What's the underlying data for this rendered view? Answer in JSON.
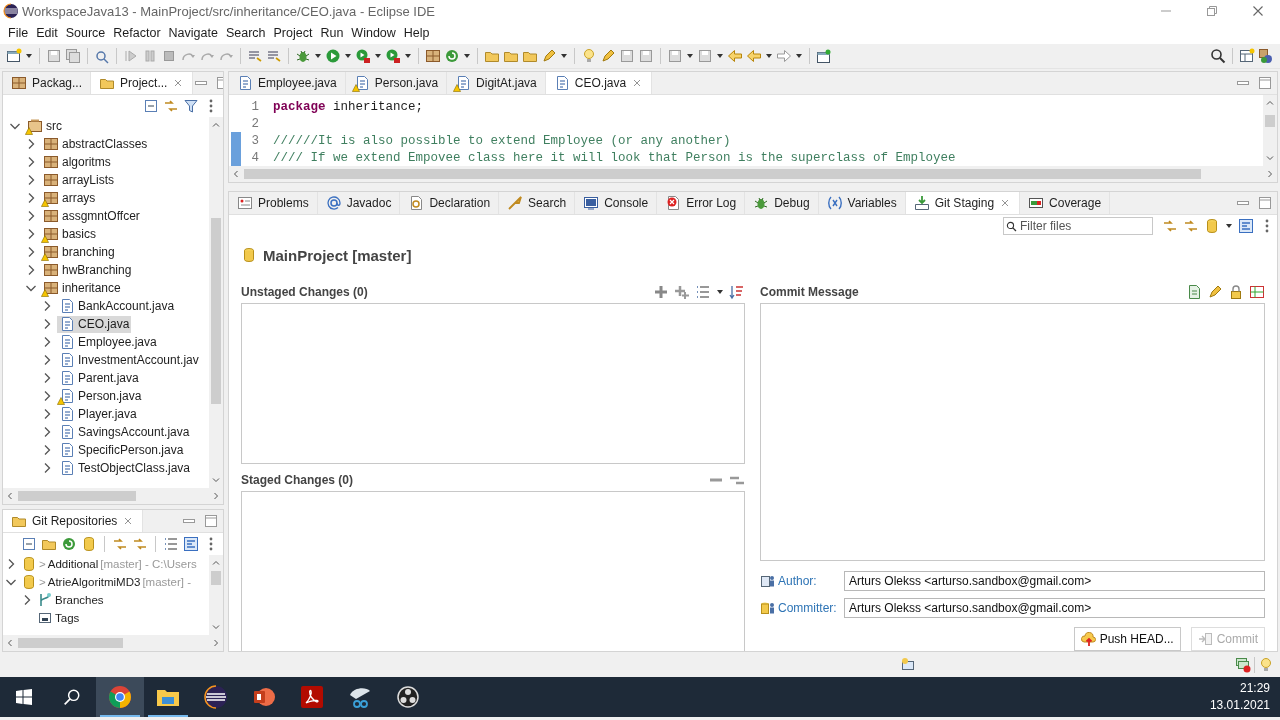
{
  "window": {
    "title": "WorkspaceJava13 - MainProject/src/inheritance/CEO.java - Eclipse IDE"
  },
  "menu": [
    "File",
    "Edit",
    "Source",
    "Refactor",
    "Navigate",
    "Search",
    "Project",
    "Run",
    "Window",
    "Help"
  ],
  "explorer": {
    "tabs": [
      {
        "label": "Packag...",
        "selected": false,
        "closable": false
      },
      {
        "label": "Project...",
        "selected": true,
        "closable": true
      }
    ],
    "tree": [
      {
        "label": "src",
        "kind": "source",
        "warning": true,
        "expanded": true,
        "selected": false,
        "children": [
          {
            "label": "abstractClasses",
            "kind": "package",
            "warning": false,
            "expanded": false,
            "selected": false
          },
          {
            "label": "algoritms",
            "kind": "package",
            "warning": false,
            "expanded": false,
            "selected": false
          },
          {
            "label": "arrayLists",
            "kind": "package",
            "warning": false,
            "expanded": false,
            "selected": false
          },
          {
            "label": "arrays",
            "kind": "package",
            "warning": true,
            "expanded": false,
            "selected": false
          },
          {
            "label": "assgmntOffcer",
            "kind": "package",
            "warning": false,
            "expanded": false,
            "selected": false
          },
          {
            "label": "basics",
            "kind": "package",
            "warning": true,
            "expanded": false,
            "selected": false
          },
          {
            "label": "branching",
            "kind": "package",
            "warning": true,
            "expanded": false,
            "selected": false
          },
          {
            "label": "hwBranching",
            "kind": "package",
            "warning": false,
            "expanded": false,
            "selected": false
          },
          {
            "label": "inheritance",
            "kind": "package",
            "warning": true,
            "expanded": true,
            "selected": false,
            "children": [
              {
                "label": "BankAccount.java",
                "kind": "file",
                "warning": false,
                "expanded": false,
                "selected": false
              },
              {
                "label": "CEO.java",
                "kind": "file",
                "warning": false,
                "expanded": false,
                "selected": true
              },
              {
                "label": "Employee.java",
                "kind": "file",
                "warning": false,
                "expanded": false,
                "selected": false
              },
              {
                "label": "InvestmentAccount.jav",
                "kind": "file",
                "warning": false,
                "expanded": false,
                "selected": false
              },
              {
                "label": "Parent.java",
                "kind": "file",
                "warning": false,
                "expanded": false,
                "selected": false
              },
              {
                "label": "Person.java",
                "kind": "file",
                "warning": true,
                "expanded": false,
                "selected": false
              },
              {
                "label": "Player.java",
                "kind": "file",
                "warning": false,
                "expanded": false,
                "selected": false
              },
              {
                "label": "SavingsAccount.java",
                "kind": "file",
                "warning": false,
                "expanded": false,
                "selected": false
              },
              {
                "label": "SpecificPerson.java",
                "kind": "file",
                "warning": false,
                "expanded": false,
                "selected": false
              },
              {
                "label": "TestObjectClass.java",
                "kind": "file",
                "warning": false,
                "expanded": false,
                "selected": false
              }
            ]
          }
        ]
      }
    ]
  },
  "repositories": {
    "tab": "Git Repositories",
    "repos": [
      {
        "marker": ">",
        "name": "Additional",
        "branch": "[master]",
        "path": "- C:\\Users",
        "expanded": false
      },
      {
        "marker": ">",
        "name": "AtrieAlgoritmiMD3",
        "branch": "[master]",
        "path": "-",
        "expanded": true,
        "children": [
          {
            "label": "Branches",
            "kind": "branches",
            "expanded": false
          },
          {
            "label": "Tags",
            "kind": "tags"
          }
        ]
      }
    ]
  },
  "editor": {
    "tabs": [
      {
        "label": "Employee.java",
        "selected": false,
        "warning": false
      },
      {
        "label": "Person.java",
        "selected": false,
        "warning": true
      },
      {
        "label": "DigitAt.java",
        "selected": false,
        "warning": true
      },
      {
        "label": "CEO.java",
        "selected": true,
        "warning": false
      }
    ],
    "lines": [
      {
        "number": "1",
        "changed": false,
        "tokens": [
          {
            "kind": "keyword",
            "text": "package"
          },
          {
            "kind": "plain",
            "text": " inheritance;"
          }
        ]
      },
      {
        "number": "2",
        "changed": false
      },
      {
        "number": "3",
        "changed": true,
        "tokens": [
          {
            "kind": "comment",
            "text": "//////It is also possible to extend Employee (or any another)"
          }
        ]
      },
      {
        "number": "4",
        "changed": true,
        "tokens": [
          {
            "kind": "comment",
            "text": "//// If we extend Empovee class here it will look that Person is the superclass of Employee"
          }
        ]
      }
    ]
  },
  "views": {
    "tabs": [
      {
        "label": "Problems",
        "selected": false
      },
      {
        "label": "Javadoc",
        "selected": false
      },
      {
        "label": "Declaration",
        "selected": false
      },
      {
        "label": "Search",
        "selected": false
      },
      {
        "label": "Console",
        "selected": false
      },
      {
        "label": "Error Log",
        "selected": false
      },
      {
        "label": "Debug",
        "selected": false
      },
      {
        "label": "Variables",
        "selected": false
      },
      {
        "label": "Git Staging",
        "selected": true
      },
      {
        "label": "Coverage",
        "selected": false
      }
    ],
    "filter": {
      "placeholder": "Filter files"
    },
    "repository": "MainProject [master]",
    "unstaged": "Unstaged Changes (0)",
    "staged": "Staged Changes (0)",
    "commit_message": "Commit Message",
    "author": {
      "label": "Author:",
      "value": "Arturs Olekss <arturso.sandbox@gmail.com>"
    },
    "committer": {
      "label": "Committer:",
      "value": "Arturs Olekss <arturso.sandbox@gmail.com>"
    },
    "buttons": [
      {
        "label": "Push HEAD...",
        "disabled": false
      },
      {
        "label": "Commit",
        "disabled": true
      }
    ]
  },
  "taskbar": {
    "apps": [
      {
        "kind": "browser",
        "selected": true,
        "running": true
      },
      {
        "kind": "folder",
        "selected": false,
        "running": true
      },
      {
        "kind": "ide",
        "selected": false,
        "running": false
      },
      {
        "kind": "slides",
        "selected": false,
        "running": false
      },
      {
        "kind": "pdf",
        "selected": false,
        "running": false
      },
      {
        "kind": "snip",
        "selected": false,
        "running": false
      },
      {
        "kind": "recorder",
        "selected": false,
        "running": false
      }
    ],
    "time": "21:29",
    "date": "13.01.2021"
  }
}
